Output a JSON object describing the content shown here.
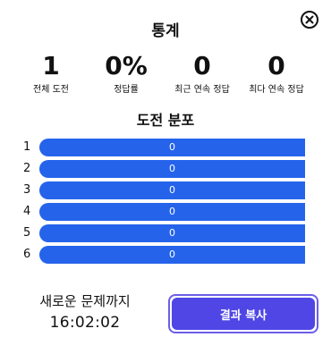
{
  "modal": {
    "title": "통계",
    "close_icon": "close-circle-icon"
  },
  "stats": [
    {
      "value": "1",
      "label": "전체 도전"
    },
    {
      "value": "0%",
      "label": "정답률"
    },
    {
      "value": "0",
      "label": "최근 연속 정답"
    },
    {
      "value": "0",
      "label": "최다 연속 정답"
    }
  ],
  "distribution": {
    "title": "도전 분포",
    "rows": [
      {
        "guess": "1",
        "count": "0"
      },
      {
        "guess": "2",
        "count": "0"
      },
      {
        "guess": "3",
        "count": "0"
      },
      {
        "guess": "4",
        "count": "0"
      },
      {
        "guess": "5",
        "count": "0"
      },
      {
        "guess": "6",
        "count": "0"
      }
    ],
    "bar_color": "#2563eb"
  },
  "footer": {
    "next_label": "새로운 문제까지",
    "countdown": "16:02:02",
    "share_label": "결과 복사",
    "share_color": "#4f46e5"
  }
}
